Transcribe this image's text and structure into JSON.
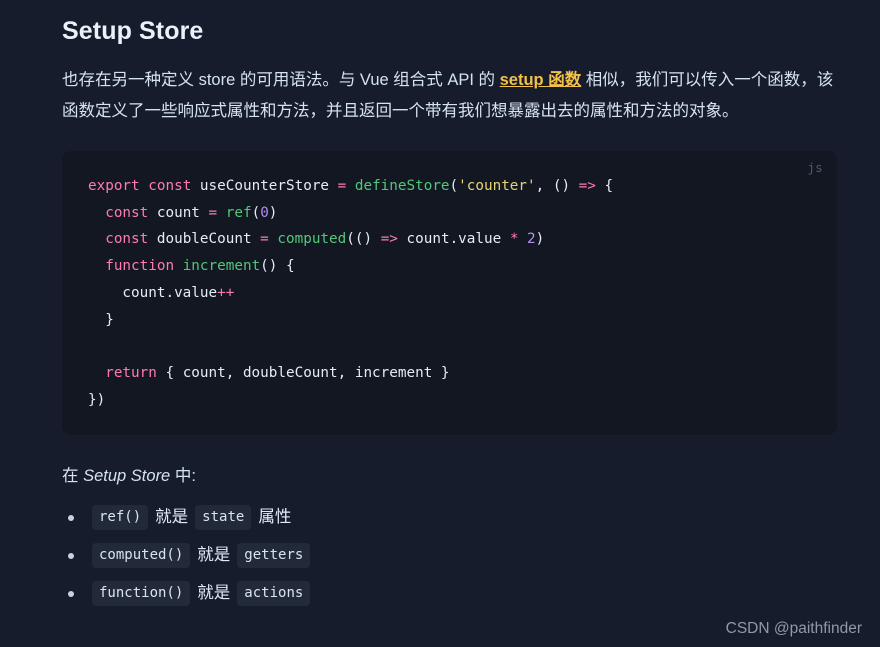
{
  "page": {
    "background_color": "#161c2b",
    "heading": "Setup Store"
  },
  "intro": {
    "part1": "也存在另一种定义 store 的可用语法。与 Vue 组合式 API 的 ",
    "link": "setup 函数",
    "link_color": "#f2c14a",
    "part2": " 相似，我们可以传入一个函数，该函数定义了一些响应式属性和方法，并且返回一个带有我们想暴露出去的属性和方法的对象。"
  },
  "code_block": {
    "language_label": "js",
    "background_color": "#121722",
    "lines": [
      [
        {
          "t": "export",
          "c": "kw"
        },
        {
          "t": " ",
          "c": "plain"
        },
        {
          "t": "const",
          "c": "kw"
        },
        {
          "t": " useCounterStore ",
          "c": "plain"
        },
        {
          "t": "=",
          "c": "op"
        },
        {
          "t": " ",
          "c": "plain"
        },
        {
          "t": "defineStore",
          "c": "fn"
        },
        {
          "t": "(",
          "c": "punc"
        },
        {
          "t": "'counter'",
          "c": "str"
        },
        {
          "t": ", () ",
          "c": "punc"
        },
        {
          "t": "=>",
          "c": "op"
        },
        {
          "t": " {",
          "c": "punc"
        }
      ],
      [
        {
          "t": "  ",
          "c": "plain"
        },
        {
          "t": "const",
          "c": "kw"
        },
        {
          "t": " count ",
          "c": "plain"
        },
        {
          "t": "=",
          "c": "op"
        },
        {
          "t": " ",
          "c": "plain"
        },
        {
          "t": "ref",
          "c": "fn"
        },
        {
          "t": "(",
          "c": "punc"
        },
        {
          "t": "0",
          "c": "num"
        },
        {
          "t": ")",
          "c": "punc"
        }
      ],
      [
        {
          "t": "  ",
          "c": "plain"
        },
        {
          "t": "const",
          "c": "kw"
        },
        {
          "t": " doubleCount ",
          "c": "plain"
        },
        {
          "t": "=",
          "c": "op"
        },
        {
          "t": " ",
          "c": "plain"
        },
        {
          "t": "computed",
          "c": "fn"
        },
        {
          "t": "(() ",
          "c": "punc"
        },
        {
          "t": "=>",
          "c": "op"
        },
        {
          "t": " count.value ",
          "c": "plain"
        },
        {
          "t": "*",
          "c": "op"
        },
        {
          "t": " ",
          "c": "plain"
        },
        {
          "t": "2",
          "c": "num"
        },
        {
          "t": ")",
          "c": "punc"
        }
      ],
      [
        {
          "t": "  ",
          "c": "plain"
        },
        {
          "t": "function",
          "c": "kw"
        },
        {
          "t": " ",
          "c": "plain"
        },
        {
          "t": "increment",
          "c": "fn"
        },
        {
          "t": "() {",
          "c": "punc"
        }
      ],
      [
        {
          "t": "    count.value",
          "c": "plain"
        },
        {
          "t": "++",
          "c": "op"
        }
      ],
      [
        {
          "t": "  }",
          "c": "punc"
        }
      ],
      [
        {
          "t": "",
          "c": "plain"
        }
      ],
      [
        {
          "t": "  ",
          "c": "plain"
        },
        {
          "t": "return",
          "c": "kw"
        },
        {
          "t": " { count, doubleCount, increment }",
          "c": "plain"
        }
      ],
      [
        {
          "t": "})",
          "c": "punc"
        }
      ]
    ]
  },
  "sub_paragraph": {
    "prefix": "在 ",
    "emphasis": "Setup Store",
    "suffix": " 中:"
  },
  "bullets": [
    {
      "code1": "ref()",
      "text": "就是",
      "code2": "state",
      "tail": "属性"
    },
    {
      "code1": "computed()",
      "text": "就是",
      "code2": "getters",
      "tail": ""
    },
    {
      "code1": "function()",
      "text": "就是",
      "code2": "actions",
      "tail": ""
    }
  ],
  "watermark": "CSDN @paithfinder"
}
